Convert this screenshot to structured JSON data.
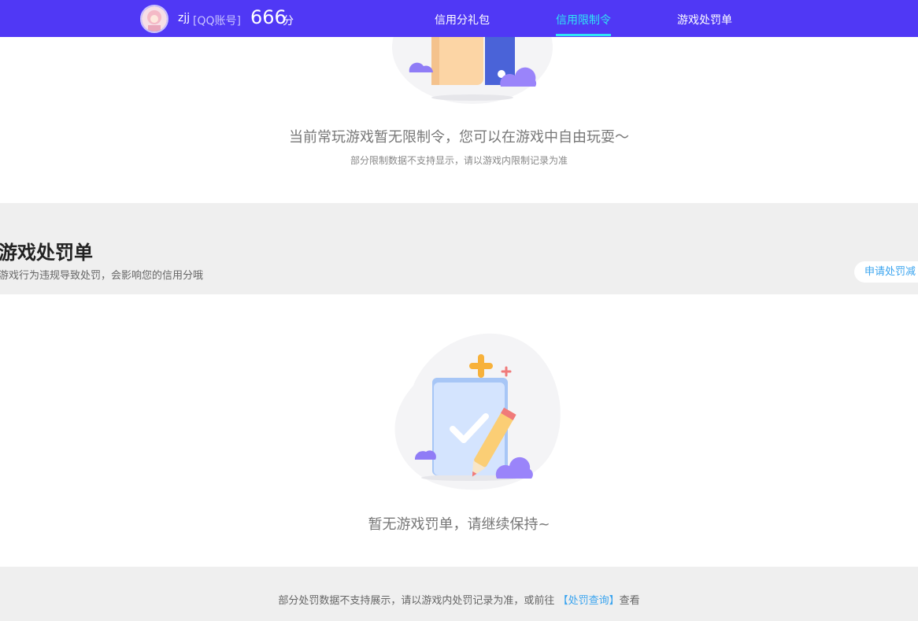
{
  "header": {
    "username": "zjj",
    "account_type": "[QQ账号]",
    "score": "666",
    "score_unit": "分",
    "tabs": [
      {
        "label": "信用分礼包"
      },
      {
        "label": "信用限制令"
      },
      {
        "label": "游戏处罚单"
      }
    ],
    "active_tab": "信用限制令"
  },
  "restriction": {
    "empty_title": "当前常玩游戏暂无限制令，您可以在游戏中自由玩耍～",
    "empty_note": "部分限制数据不支持显示，请以游戏内限制记录为准"
  },
  "penalty": {
    "title": "游戏处罚单",
    "description": "游戏行为违规导致处罚，会影响您的信用分哦",
    "appeal_button": "申请处罚减",
    "empty_title": "暂无游戏罚单，请继续保持~"
  },
  "footer": {
    "text_before": "部分处罚数据不支持展示，请以游戏内处罚记录为准，或前往",
    "link": "【处罚查询】",
    "text_after": "查看"
  },
  "colors": {
    "header_bg": "#5038f5",
    "active_tab": "#2fe6f4",
    "link": "#3aa4ef",
    "page_bg": "#efefef"
  }
}
